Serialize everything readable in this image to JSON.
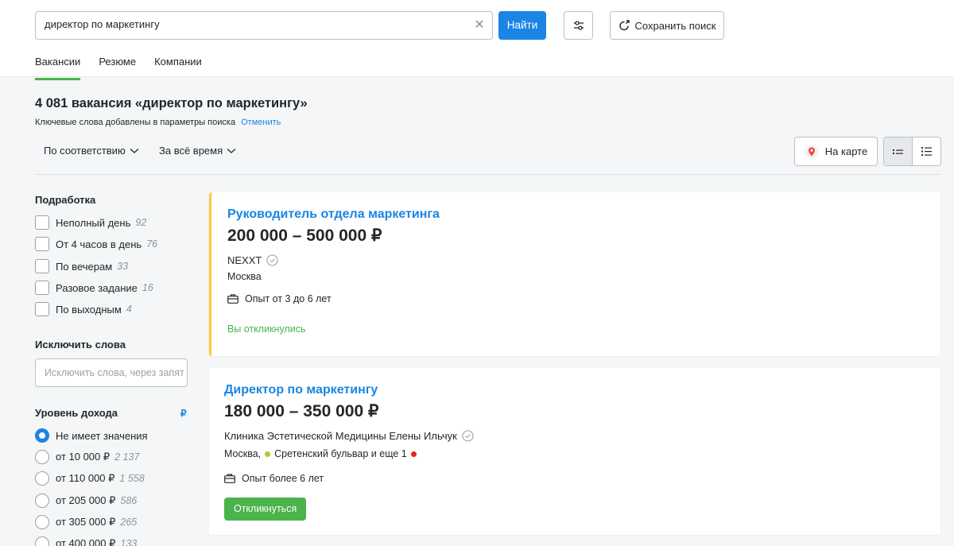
{
  "search": {
    "value": "директор по маркетингу",
    "find_label": "Найти",
    "save_label": "Сохранить поиск"
  },
  "tabs": [
    {
      "label": "Вакансии",
      "active": true
    },
    {
      "label": "Резюме",
      "active": false
    },
    {
      "label": "Компании",
      "active": false
    }
  ],
  "results": {
    "title": "4 081 вакансия «директор по маркетингу»",
    "keywords_note": "Ключевые слова добавлены в параметры поиска",
    "undo_label": "Отменить",
    "sort_label": "По соответствию",
    "period_label": "За всё время",
    "map_label": "На карте"
  },
  "filters": {
    "parttime": {
      "title": "Подработка",
      "items": [
        {
          "label": "Неполный день",
          "count": "92"
        },
        {
          "label": "От 4 часов в день",
          "count": "76"
        },
        {
          "label": "По вечерам",
          "count": "33"
        },
        {
          "label": "Разовое задание",
          "count": "16"
        },
        {
          "label": "По выходным",
          "count": "4"
        }
      ]
    },
    "exclude": {
      "title": "Исключить слова",
      "placeholder": "Исключить слова, через запятую"
    },
    "income": {
      "title": "Уровень дохода",
      "currency": "₽",
      "items": [
        {
          "label": "Не имеет значения",
          "count": "",
          "selected": true
        },
        {
          "label": "от 10 000 ₽",
          "count": "2 137",
          "selected": false
        },
        {
          "label": "от 110 000 ₽",
          "count": "1 558",
          "selected": false
        },
        {
          "label": "от 205 000 ₽",
          "count": "586",
          "selected": false
        },
        {
          "label": "от 305 000 ₽",
          "count": "265",
          "selected": false
        },
        {
          "label": "от 400 000 ₽",
          "count": "133",
          "selected": false
        }
      ]
    }
  },
  "vacancies": [
    {
      "title": "Руководитель отдела маркетинга",
      "salary": "200 000 – 500 000 ₽",
      "company": "NEXXT",
      "city": "Москва",
      "experience": "Опыт от 3 до 6 лет",
      "status": "Вы откликнулись"
    },
    {
      "title": "Директор по маркетингу",
      "salary": "180 000 – 350 000 ₽",
      "company": "Клиника Эстетической Медицины Елены Ильчук",
      "city": "Москва,",
      "metro": "Сретенский бульвар и еще 1",
      "metro_color_1": "#a3d22c",
      "metro_color_2": "#e4261c",
      "experience": "Опыт более 6 лет",
      "respond_label": "Откликнуться"
    }
  ]
}
